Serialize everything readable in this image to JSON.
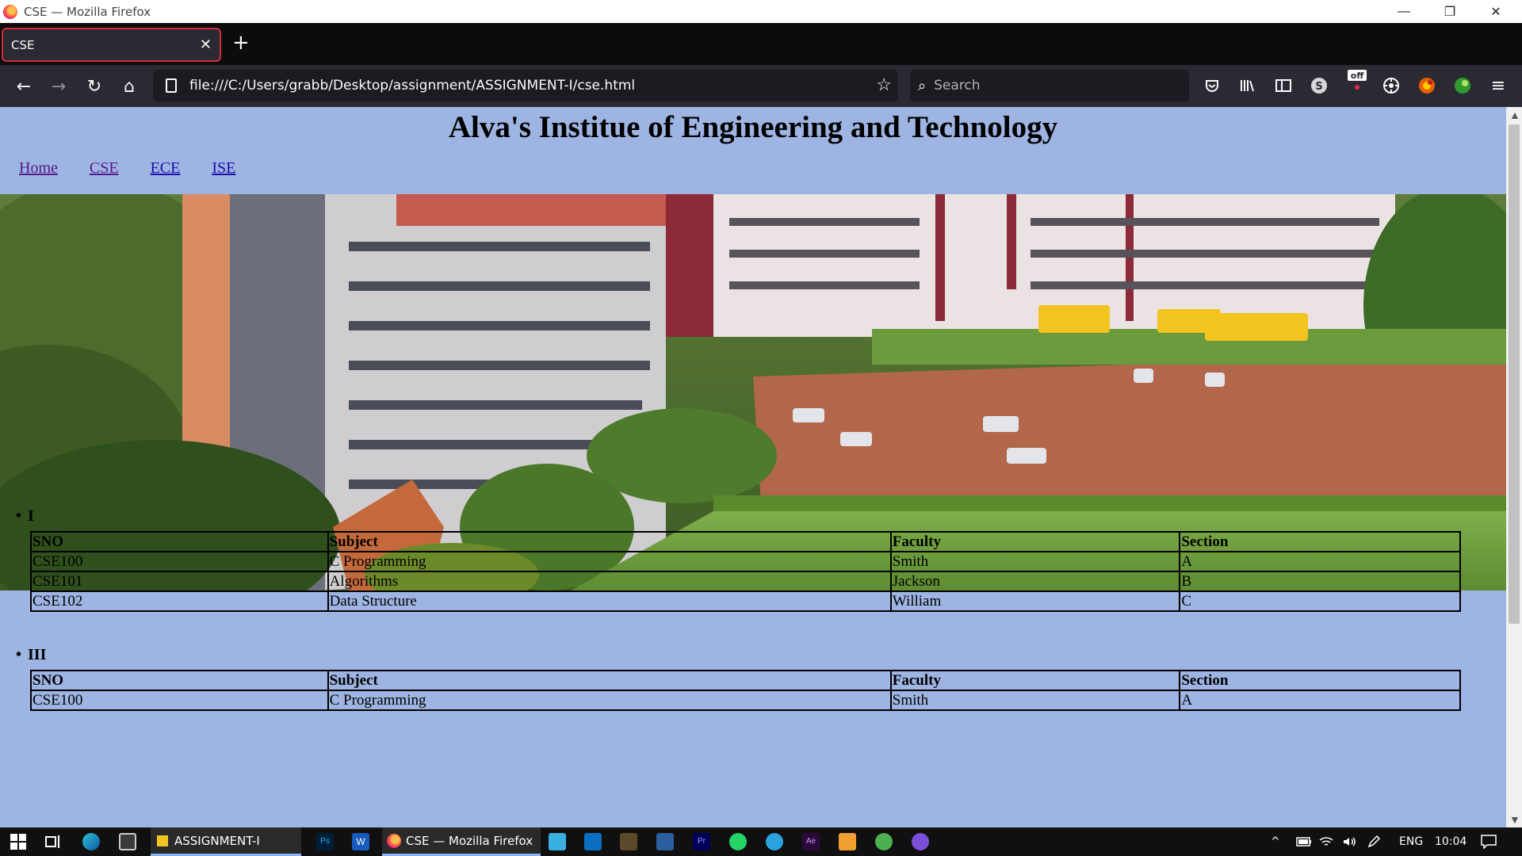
{
  "window": {
    "title": "CSE — Mozilla Firefox",
    "minimize_glyph": "—",
    "restore_glyph": "❐",
    "close_glyph": "✕"
  },
  "tabs": [
    {
      "label": "CSE",
      "close_glyph": "✕",
      "active": true
    }
  ],
  "new_tab_glyph": "+",
  "toolbar": {
    "back_glyph": "←",
    "forward_glyph": "→",
    "reload_glyph": "↻",
    "home_glyph": "⌂",
    "url": "file:///C:/Users/grabb/Desktop/assignment/ASSIGNMENT-I/cse.html",
    "bookmark_glyph": "☆",
    "search_placeholder": "Search",
    "search_glyph": "⌕",
    "icons": [
      "pocket-icon",
      "library-icon",
      "sidebar-icon",
      "account-icon",
      "extension-off-icon",
      "extension-icon",
      "extension-fox-icon",
      "extension-green-icon",
      "menu-icon"
    ],
    "menu_glyph": "≡",
    "off_badge": "off"
  },
  "page": {
    "title": "Alva's Institue of Engineering and Technology",
    "nav": [
      {
        "label": "Home",
        "visited": true
      },
      {
        "label": "CSE",
        "visited": true
      },
      {
        "label": "ECE",
        "visited": false
      },
      {
        "label": "ISE",
        "visited": false
      }
    ],
    "banner_alt": "Campus photo",
    "columns": [
      "SNO",
      "Subject",
      "Faculty",
      "Section"
    ],
    "sections": [
      {
        "heading": "I",
        "rows": [
          [
            "CSE100",
            "C Programming",
            "Smith",
            "A"
          ],
          [
            "CSE101",
            "Algorithms",
            "Jackson",
            "B"
          ],
          [
            "CSE102",
            "Data Structure",
            "William",
            "C"
          ]
        ]
      },
      {
        "heading": "III",
        "rows": [
          [
            "CSE100",
            "C Programming",
            "Smith",
            "A"
          ]
        ]
      }
    ],
    "colors": {
      "background": "#9eb4e2",
      "link": "#1a0dab",
      "visited_link": "#551a8b"
    }
  },
  "taskbar": {
    "apps": [
      {
        "label": "ASSIGNMENT-I",
        "icon": "folder-icon"
      },
      {
        "label": "CSE — Mozilla Firefox",
        "icon": "firefox-icon"
      }
    ],
    "tray": {
      "language": "ENG",
      "time": "10:04"
    },
    "chevron_glyph": "^"
  }
}
